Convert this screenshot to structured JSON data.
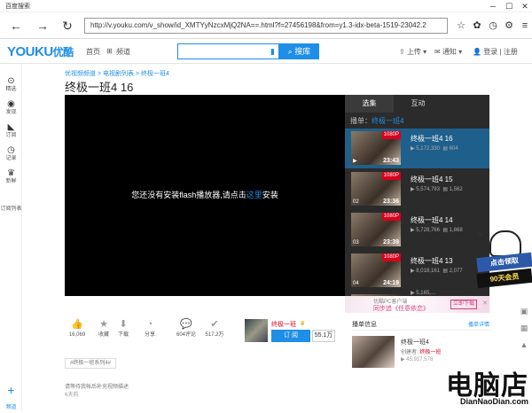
{
  "browser": {
    "window_title": "百度搜索",
    "url": "http://v.youku.com/v_show/id_XMTYyNzcxMjQ2NA==.html?f=27456198&from=y1.3-idx-beta-1519-23042.2",
    "minimize": "─",
    "maximize": "☐",
    "close": "✕",
    "back": "←",
    "forward": "→",
    "reload": "↻"
  },
  "header": {
    "logo": "YOUKU",
    "logo_cn": "优酷",
    "nav": [
      "首页",
      "频道"
    ],
    "search_placeholder": "",
    "search_button": "搜库",
    "upload": "上传",
    "notify": "通知",
    "login": "登录 | 注册"
  },
  "rail": [
    {
      "label": "精选"
    },
    {
      "label": "发现"
    },
    {
      "label": "订阅"
    },
    {
      "label": "记录"
    },
    {
      "label": "新鲜"
    },
    {
      "label": "订阅列表"
    }
  ],
  "rail_bottom": {
    "label": "频道"
  },
  "breadcrumb": "优视频频道 > 电视剧列表 > 终极一班4",
  "video": {
    "title": "终极一班4 16",
    "player_msg_prefix": "您还没有安装flash播放器,请点击",
    "player_msg_link": "这里",
    "player_msg_suffix": "安装"
  },
  "playlist": {
    "tabs": [
      "选集",
      "互动"
    ],
    "current_prefix": "播单：",
    "current_name": "终极一班4",
    "episodes": [
      {
        "title": "终极一班4 16",
        "badge": "1080P",
        "duration": "23:43",
        "num": "▶",
        "plays": "5,172,330",
        "comments": "604"
      },
      {
        "title": "终极一班4 15",
        "badge": "1080P",
        "duration": "23:36",
        "num": "02",
        "plays": "5,574,793",
        "comments": "1,562"
      },
      {
        "title": "终极一班4 14",
        "badge": "1080P",
        "duration": "23:39",
        "num": "03",
        "plays": "5,728,766",
        "comments": "1,868"
      },
      {
        "title": "终极一班4 13",
        "badge": "1080P",
        "duration": "24:19",
        "num": "04",
        "plays": "8,018,161",
        "comments": "2,077"
      },
      {
        "title": "",
        "badge": "",
        "duration": "",
        "num": "",
        "plays": "5,165,...",
        "comments": ""
      }
    ]
  },
  "actions": [
    {
      "icon": "👍",
      "label": "16,069"
    },
    {
      "icon": "★",
      "label": "收藏"
    },
    {
      "icon": "⬇",
      "label": "下载"
    },
    {
      "icon": "◔",
      "label": "分享"
    },
    {
      "icon": "💬",
      "label": "604评论"
    },
    {
      "icon": "✔",
      "label": "517.2万"
    }
  ],
  "channel": {
    "name": "终极一班",
    "subscribe": "订 阅",
    "count": "55.1万"
  },
  "tag": "#终极一班系列4#",
  "description": "请等待我帐后补充视频描述",
  "posted": "6天前",
  "ad": {
    "line1": "优酷PC客户端",
    "line2": "同步追《任意依恋》",
    "button": "立即下载",
    "close": "✕"
  },
  "uploader": {
    "heading": "播单信息",
    "more": "播单详情",
    "name": "终极一班4",
    "by_prefix": "创建者: ",
    "by": "终极一班",
    "plays": "45,917,578"
  },
  "promo": {
    "line1": "点击领取",
    "line2": "90天会员"
  },
  "watermark": {
    "big": "电脑店",
    "small": "DianNaoDian.com"
  }
}
